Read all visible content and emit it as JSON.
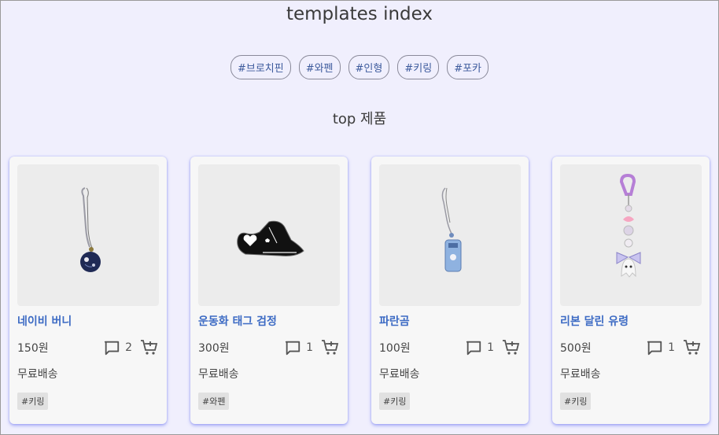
{
  "page": {
    "title": "templates index",
    "section_title": "top 제품"
  },
  "tags": [
    "#브로치핀",
    "#와펜",
    "#인형",
    "#키링",
    "#포카"
  ],
  "products": [
    {
      "name": "네이비 버니",
      "price": "150원",
      "comments": "2",
      "shipping": "무료배송",
      "tag": "#키링",
      "image": "keyring-navy-bunny"
    },
    {
      "name": "운동화 태그 검정",
      "price": "300원",
      "comments": "1",
      "shipping": "무료배송",
      "tag": "#와펜",
      "image": "sneaker-tag-black"
    },
    {
      "name": "파란곰",
      "price": "100원",
      "comments": "1",
      "shipping": "무료배송",
      "tag": "#키링",
      "image": "keyring-blue-bear"
    },
    {
      "name": "리본 달린 유령",
      "price": "500원",
      "comments": "1",
      "shipping": "무료배송",
      "tag": "#키링",
      "image": "keyring-ribbon-ghost"
    }
  ],
  "icons": {
    "comment": "comment-icon",
    "cart": "add-to-cart-icon"
  },
  "colors": {
    "background": "#f0effd",
    "link": "#3d6bc4",
    "card_shadow": "#6e78f0"
  }
}
